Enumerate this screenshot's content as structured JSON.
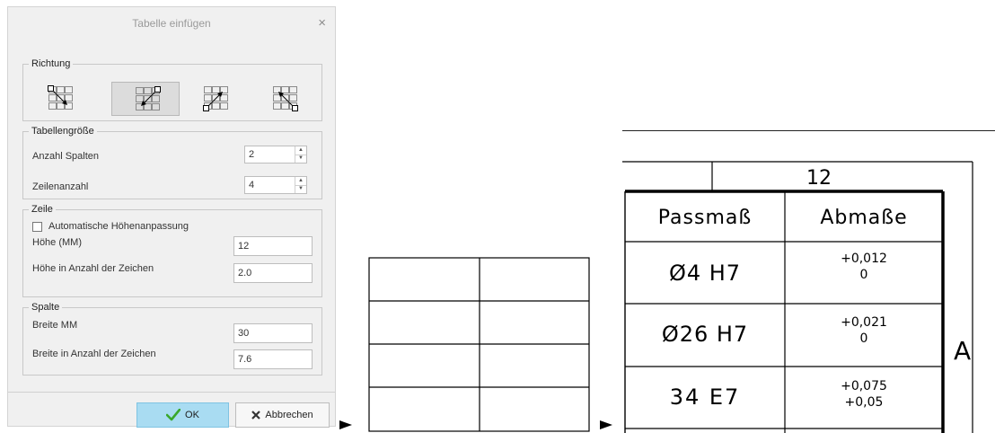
{
  "dialog": {
    "title": "Tabelle einfügen",
    "close_glyph": "×",
    "direction": {
      "label": "Richtung",
      "options": [
        "down-right",
        "down-left",
        "up-right",
        "up-left"
      ],
      "selected_index": 1
    },
    "table_size": {
      "label": "Tabellengröße",
      "columns_label": "Anzahl Spalten",
      "columns_value": "2",
      "rows_label": "Zeilenanzahl",
      "rows_value": "4"
    },
    "row": {
      "label": "Zeile",
      "auto_height_label": "Automatische Höhenanpassung",
      "auto_height_checked": false,
      "height_mm_label": "Höhe (MM)",
      "height_mm_value": "12",
      "height_chars_label": "Höhe in Anzahl der Zeichen",
      "height_chars_value": "2.0"
    },
    "column": {
      "label": "Spalte",
      "width_mm_label": "Breite MM",
      "width_mm_value": "30",
      "width_chars_label": "Breite in Anzahl der Zeichen",
      "width_chars_value": "7.6"
    },
    "ok_label": "OK",
    "cancel_label": "Abbrechen",
    "ok_color": "#a9dcf2",
    "check_color": "#3aa82c",
    "cancel_x_color": "#333333"
  },
  "drawing": {
    "top_dimension": "12",
    "side_label": "A",
    "headers": [
      "Passmaß",
      "Abmaße"
    ],
    "rows": [
      {
        "fit": "Ø4 H7",
        "upper": "+0,012",
        "lower": "0"
      },
      {
        "fit": "Ø26 H7",
        "upper": "+0,021",
        "lower": "0"
      },
      {
        "fit": "34 E7",
        "upper": "+0,075",
        "lower": "+0,05"
      }
    ]
  }
}
